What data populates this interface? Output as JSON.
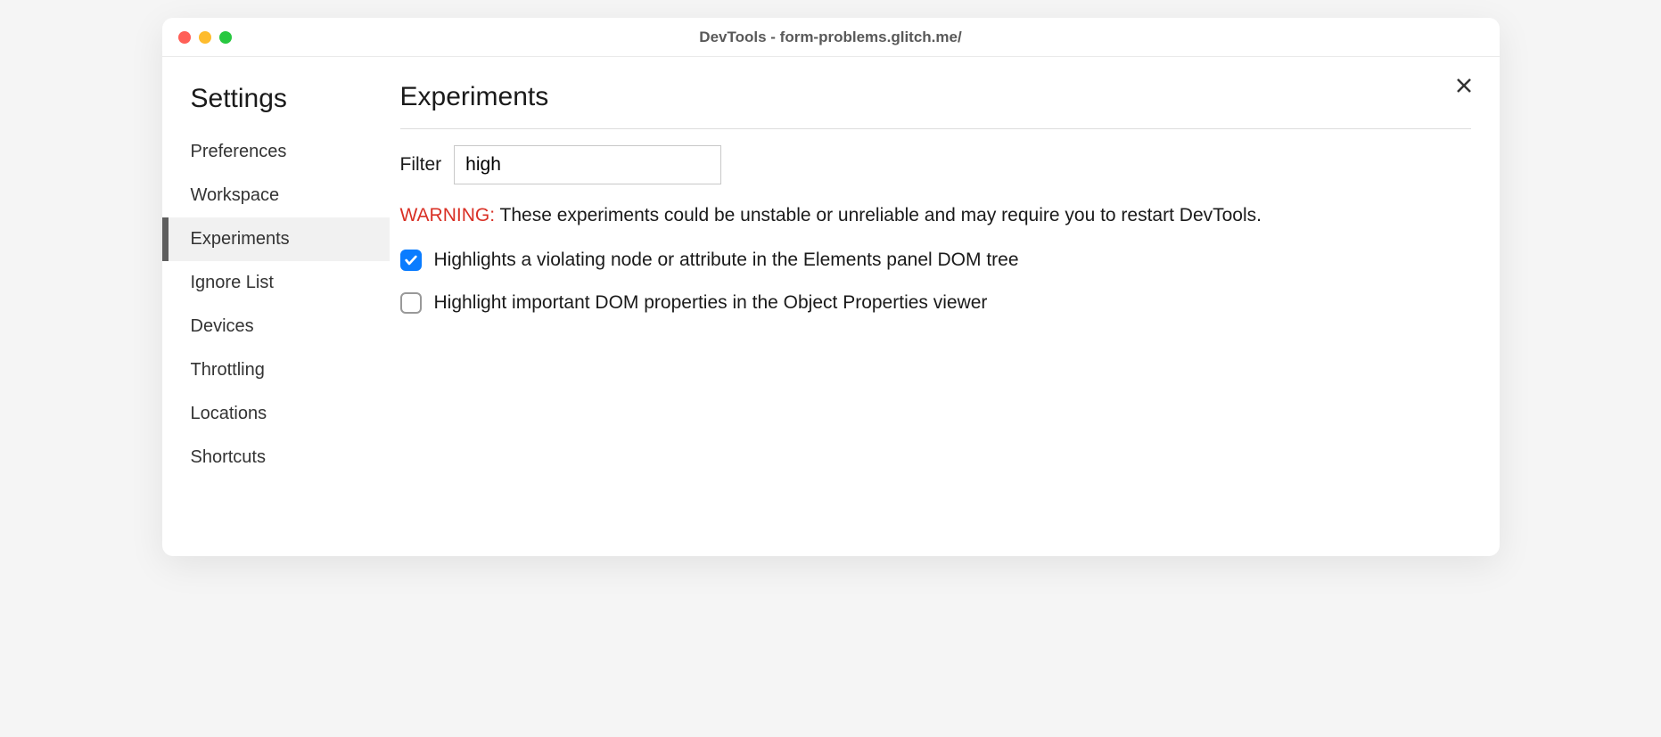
{
  "window": {
    "title": "DevTools - form-problems.glitch.me/"
  },
  "sidebar": {
    "title": "Settings",
    "items": [
      {
        "label": "Preferences",
        "active": false
      },
      {
        "label": "Workspace",
        "active": false
      },
      {
        "label": "Experiments",
        "active": true
      },
      {
        "label": "Ignore List",
        "active": false
      },
      {
        "label": "Devices",
        "active": false
      },
      {
        "label": "Throttling",
        "active": false
      },
      {
        "label": "Locations",
        "active": false
      },
      {
        "label": "Shortcuts",
        "active": false
      }
    ]
  },
  "main": {
    "title": "Experiments",
    "filter": {
      "label": "Filter",
      "value": "high"
    },
    "warning": {
      "label": "WARNING:",
      "text": " These experiments could be unstable or unreliable and may require you to restart DevTools."
    },
    "experiments": [
      {
        "label": "Highlights a violating node or attribute in the Elements panel DOM tree",
        "checked": true
      },
      {
        "label": "Highlight important DOM properties in the Object Properties viewer",
        "checked": false
      }
    ]
  }
}
